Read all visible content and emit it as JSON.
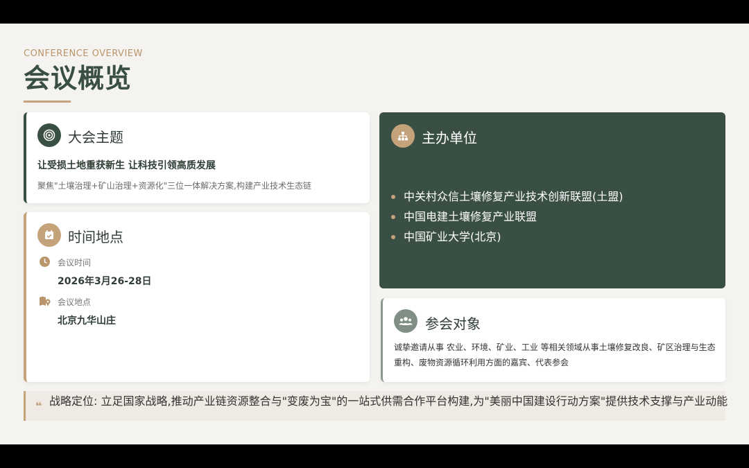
{
  "header": {
    "eyebrow": "CONFERENCE OVERVIEW",
    "title": "会议概览"
  },
  "theme_card": {
    "icon": "target-icon",
    "heading": "大会主题",
    "main": "让受损土地重获新生 让科技引领高质发展",
    "sub": "聚焦\"土壤治理+矿山治理+资源化\"三位一体解决方案,构建产业技术生态链"
  },
  "time_card": {
    "icon": "calendar-check-icon",
    "heading": "时间地点",
    "time_label": "会议时间",
    "time_value": "2026年3月26-28日",
    "place_label": "会议地点",
    "place_value": "北京九华山庄"
  },
  "host_card": {
    "icon": "org-chart-icon",
    "heading": "主办单位",
    "items": [
      "中关村众信土壤修复产业技术创新联盟(土盟)",
      "中国电建土壤修复产业联盟",
      "中国矿业大学(北京)"
    ]
  },
  "audience_card": {
    "icon": "users-icon",
    "heading": "参会对象",
    "text": "诚挚邀请从事 农业、环境、矿业、工业 等相关领域从事土壤修复改良、矿区治理与生态重构、废物资源循环利用方面的嘉宾、代表参会"
  },
  "strategy": {
    "icon": "quote-icon",
    "text": "战略定位: 立足国家战略,推动产业链资源整合与\"变废为宝\"的一站式供需合作平台构建,为\"美丽中国建设行动方案\"提供技术支撑与产业动能"
  },
  "colors": {
    "primary": "#3a4f43",
    "accent": "#c4a27a",
    "background": "#f5f3ef"
  }
}
